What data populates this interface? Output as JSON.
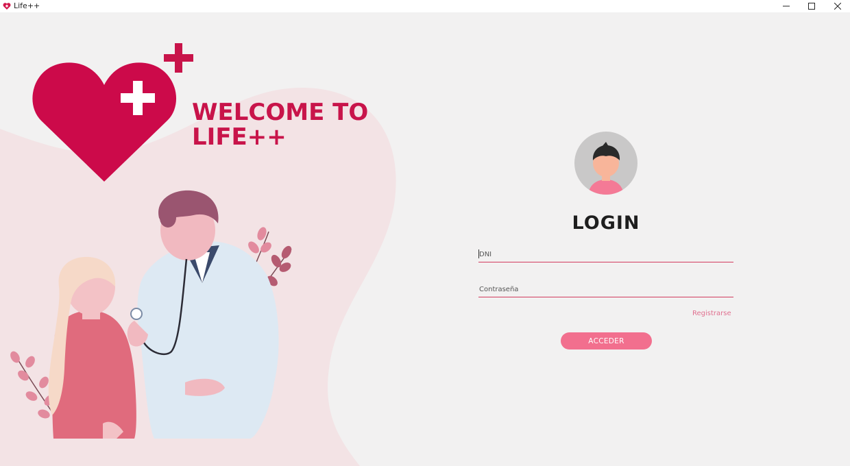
{
  "window": {
    "title": "Life++",
    "controls": {
      "minimize_icon": "minimize-icon",
      "maximize_icon": "maximize-icon",
      "close_icon": "close-icon"
    }
  },
  "hero": {
    "welcome_text": "WELCOME TO\nLIFE++",
    "logo_icon": "heart-plus-logo",
    "illustration": "doctor-and-patient-illustration"
  },
  "login": {
    "avatar_icon": "user-avatar-icon",
    "title": "LOGIN",
    "dni_placeholder": "DNI",
    "password_placeholder": "Contraseña",
    "register_label": "Registrarse",
    "submit_label": "ACCEDER"
  },
  "colors": {
    "brand": "#c8144a",
    "accent_pink": "#f26f8e",
    "field_underline": "#d23a5d",
    "background": "#f2f1f1"
  }
}
